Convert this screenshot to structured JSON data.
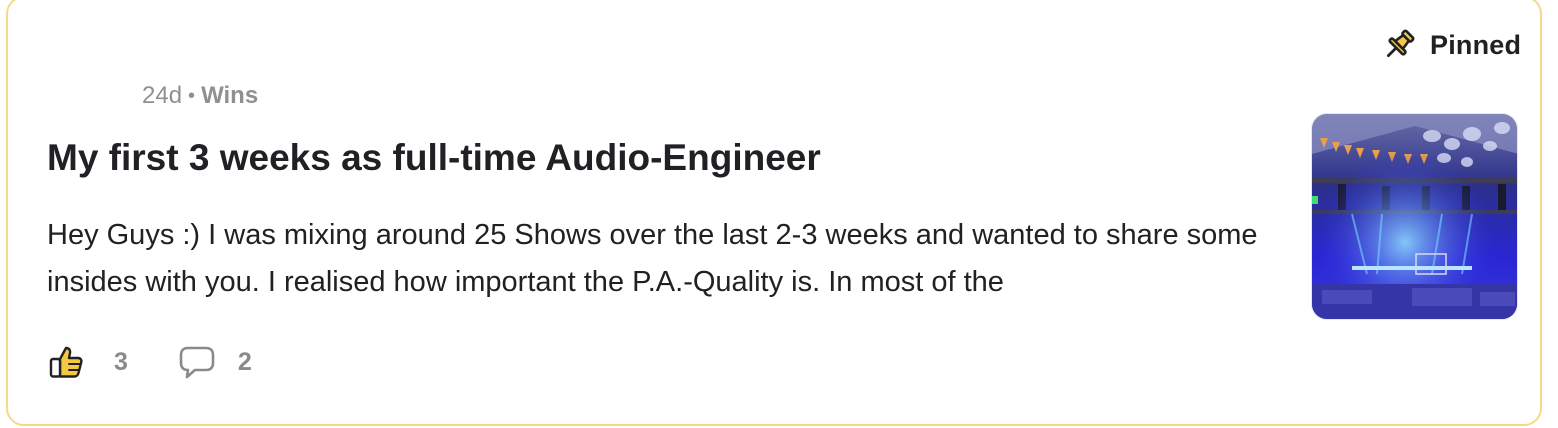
{
  "post": {
    "pinned_label": "Pinned",
    "age": "24d",
    "separator": "•",
    "category": "Wins",
    "title": "My first 3 weeks as full-time Audio-Engineer",
    "excerpt": "Hey Guys :) I was mixing around 25 Shows over the last 2-3 weeks and wanted to share some insides with you. I realised how important the P.A.-Quality is. In most of the",
    "likes": "3",
    "comments": "2"
  },
  "icons": {
    "pin": "pushpin-icon",
    "like": "thumbs-up-icon",
    "comment": "speech-bubble-icon"
  },
  "colors": {
    "card_border": "#f5d98a",
    "pin_fill": "#f5c842",
    "thumb_fill": "#f5c842",
    "text": "#202124",
    "muted": "#909090"
  }
}
